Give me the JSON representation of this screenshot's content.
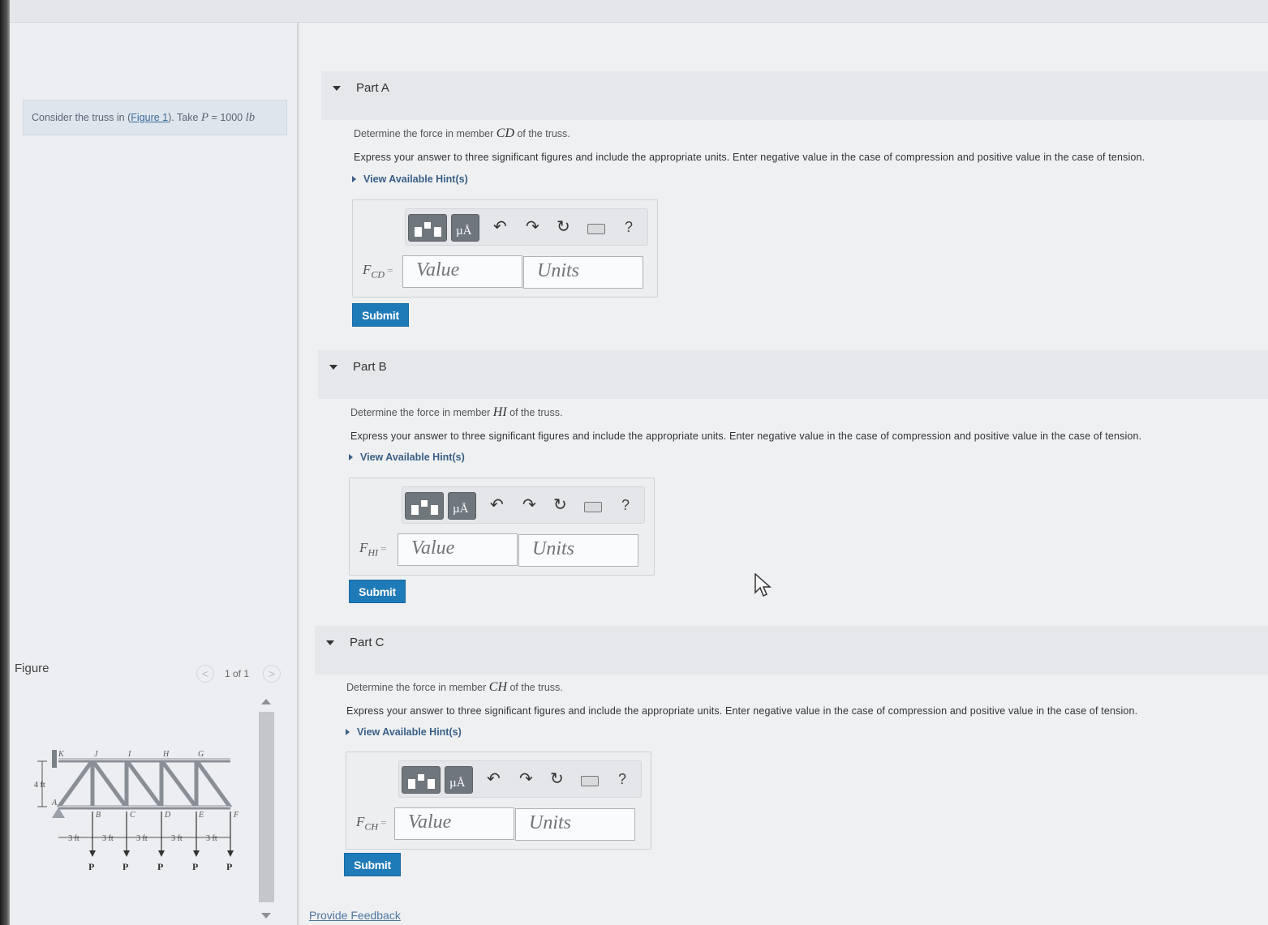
{
  "intro": {
    "text_prefix": "Consider the truss in (",
    "figure_link": "Figure 1",
    "text_mid": "). Take ",
    "p_var": "P",
    "p_value": " = 1000 ",
    "p_unit": "lb"
  },
  "figure": {
    "label": "Figure",
    "counter": "1 of 1",
    "prev_glyph": "<",
    "next_glyph": ">",
    "nodes_top": [
      "K",
      "J",
      "I",
      "H",
      "G"
    ],
    "nodes_bottom": [
      "A",
      "B",
      "C",
      "D",
      "E",
      "F"
    ],
    "height_label": "4 ft",
    "spacing_labels": [
      "3 ft",
      "3 ft",
      "3 ft",
      "3 ft",
      "3 ft"
    ],
    "load_labels": [
      "P",
      "P",
      "P",
      "P",
      "P"
    ]
  },
  "toolbar": {
    "units_glyph": "µÅ",
    "undo_glyph": "↶",
    "redo_glyph": "↷",
    "reset_glyph": "↻",
    "help_glyph": "?"
  },
  "parts": [
    {
      "title": "Part A",
      "question_prefix": "Determine the force in member ",
      "member": "CD",
      "question_suffix": " of the truss.",
      "instructions": "Express your answer to three significant figures and include the appropriate units. Enter negative value in the case of compression and positive value in the case of tension.",
      "hint": "View Available Hint(s)",
      "var_main": "F",
      "var_sub": "CD",
      "value_placeholder": "Value",
      "units_placeholder": "Units",
      "submit": "Submit"
    },
    {
      "title": "Part B",
      "question_prefix": "Determine the force in member ",
      "member": "HI",
      "question_suffix": " of the truss.",
      "instructions": "Express your answer to three significant figures and include the appropriate units. Enter negative value in the case of compression and positive value in the case of tension.",
      "hint": "View Available Hint(s)",
      "var_main": "F",
      "var_sub": "HI",
      "value_placeholder": "Value",
      "units_placeholder": "Units",
      "submit": "Submit"
    },
    {
      "title": "Part C",
      "question_prefix": "Determine the force in member ",
      "member": "CH",
      "question_suffix": " of the truss.",
      "instructions": "Express your answer to three significant figures and include the appropriate units. Enter negative value in the case of compression and positive value in the case of tension.",
      "hint": "View Available Hint(s)",
      "var_main": "F",
      "var_sub": "CH",
      "value_placeholder": "Value",
      "units_placeholder": "Units",
      "submit": "Submit"
    }
  ],
  "feedback_link": "Provide Feedback",
  "colors": {
    "submit_bg": "#1f7ab8",
    "link": "#3a5f86",
    "toolbar_button": "#6f767c"
  }
}
